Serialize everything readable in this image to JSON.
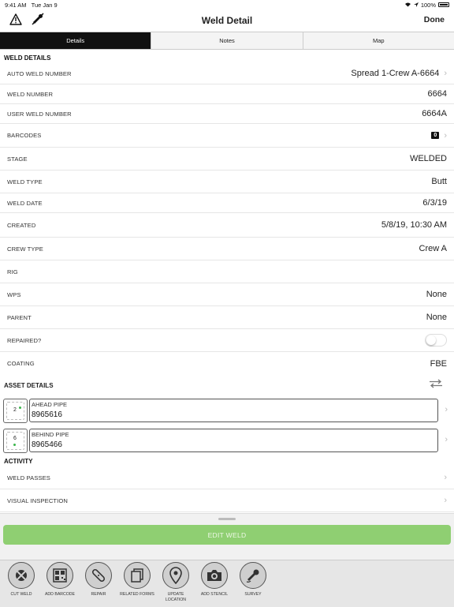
{
  "status_bar": {
    "time": "9:41 AM",
    "date": "Tue Jan 9",
    "battery": "100%"
  },
  "nav": {
    "title": "Weld Detail",
    "done_label": "Done"
  },
  "tabs": [
    {
      "label": "Details",
      "active": true
    },
    {
      "label": "Notes",
      "active": false
    },
    {
      "label": "Map",
      "active": false
    }
  ],
  "weld_details": {
    "header": "WELD DETAILS",
    "rows": [
      {
        "label": "AUTO WELD NUMBER",
        "value": "Spread 1-Crew A-6664"
      },
      {
        "label": "WELD NUMBER",
        "value": "6664"
      },
      {
        "label": "USER WELD NUMBER",
        "value": "6664A"
      },
      {
        "label": "BARCODES",
        "value": "0"
      },
      {
        "label": "STAGE",
        "value": "WELDED"
      },
      {
        "label": "WELD TYPE",
        "value": "Butt"
      },
      {
        "label": "WELD DATE",
        "value": "6/3/19"
      },
      {
        "label": "CREATED",
        "value": "5/8/19, 10:30 AM"
      },
      {
        "label": "CREW TYPE",
        "value": "Crew A"
      },
      {
        "label": "RIG",
        "value": ""
      },
      {
        "label": "WPS",
        "value": "None"
      },
      {
        "label": "PARENT",
        "value": "None"
      },
      {
        "label": "REPAIRED?",
        "value": ""
      },
      {
        "label": "COATING",
        "value": "FBE"
      }
    ]
  },
  "asset_details": {
    "header": "ASSET DETAILS",
    "items": [
      {
        "thumb_num": "2",
        "title": "AHEAD PIPE",
        "value": "8965616"
      },
      {
        "thumb_num": "6",
        "title": "BEHIND PIPE",
        "value": "8965466"
      }
    ]
  },
  "activity": {
    "header": "ACTIVITY",
    "rows": [
      {
        "label": "WELD PASSES"
      },
      {
        "label": "VISUAL INSPECTION"
      }
    ]
  },
  "edit_button_label": "EDIT WELD",
  "toolbar": [
    {
      "label": "CUT WELD",
      "icon": "cut-weld-icon"
    },
    {
      "label": "ADD BARCODE",
      "icon": "barcode-icon"
    },
    {
      "label": "REPAIR",
      "icon": "bandage-icon"
    },
    {
      "label": "RELATED FORMS",
      "icon": "forms-icon"
    },
    {
      "label": "UPDATE LOCATION",
      "icon": "location-pin-icon"
    },
    {
      "label": "ADD STENCIL",
      "icon": "camera-icon"
    },
    {
      "label": "SURVEY",
      "icon": "survey-icon"
    }
  ],
  "colors": {
    "accent_green": "#8fcf72",
    "dot_green": "#39b54a"
  }
}
